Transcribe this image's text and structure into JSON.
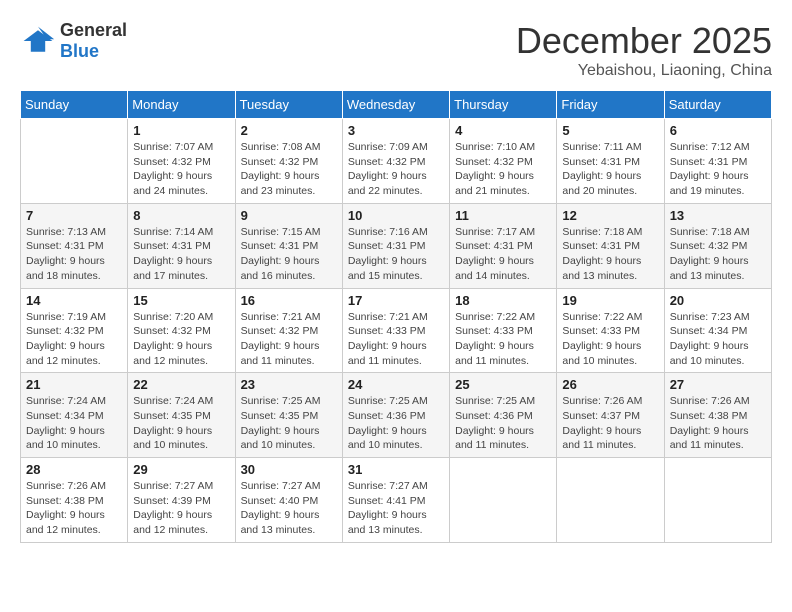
{
  "logo": {
    "line1": "General",
    "line2": "Blue"
  },
  "title": "December 2025",
  "subtitle": "Yebaishou, Liaoning, China",
  "days_of_week": [
    "Sunday",
    "Monday",
    "Tuesday",
    "Wednesday",
    "Thursday",
    "Friday",
    "Saturday"
  ],
  "weeks": [
    [
      {
        "day": "",
        "info": ""
      },
      {
        "day": "1",
        "info": "Sunrise: 7:07 AM\nSunset: 4:32 PM\nDaylight: 9 hours\nand 24 minutes."
      },
      {
        "day": "2",
        "info": "Sunrise: 7:08 AM\nSunset: 4:32 PM\nDaylight: 9 hours\nand 23 minutes."
      },
      {
        "day": "3",
        "info": "Sunrise: 7:09 AM\nSunset: 4:32 PM\nDaylight: 9 hours\nand 22 minutes."
      },
      {
        "day": "4",
        "info": "Sunrise: 7:10 AM\nSunset: 4:32 PM\nDaylight: 9 hours\nand 21 minutes."
      },
      {
        "day": "5",
        "info": "Sunrise: 7:11 AM\nSunset: 4:31 PM\nDaylight: 9 hours\nand 20 minutes."
      },
      {
        "day": "6",
        "info": "Sunrise: 7:12 AM\nSunset: 4:31 PM\nDaylight: 9 hours\nand 19 minutes."
      }
    ],
    [
      {
        "day": "7",
        "info": "Sunrise: 7:13 AM\nSunset: 4:31 PM\nDaylight: 9 hours\nand 18 minutes."
      },
      {
        "day": "8",
        "info": "Sunrise: 7:14 AM\nSunset: 4:31 PM\nDaylight: 9 hours\nand 17 minutes."
      },
      {
        "day": "9",
        "info": "Sunrise: 7:15 AM\nSunset: 4:31 PM\nDaylight: 9 hours\nand 16 minutes."
      },
      {
        "day": "10",
        "info": "Sunrise: 7:16 AM\nSunset: 4:31 PM\nDaylight: 9 hours\nand 15 minutes."
      },
      {
        "day": "11",
        "info": "Sunrise: 7:17 AM\nSunset: 4:31 PM\nDaylight: 9 hours\nand 14 minutes."
      },
      {
        "day": "12",
        "info": "Sunrise: 7:18 AM\nSunset: 4:31 PM\nDaylight: 9 hours\nand 13 minutes."
      },
      {
        "day": "13",
        "info": "Sunrise: 7:18 AM\nSunset: 4:32 PM\nDaylight: 9 hours\nand 13 minutes."
      }
    ],
    [
      {
        "day": "14",
        "info": "Sunrise: 7:19 AM\nSunset: 4:32 PM\nDaylight: 9 hours\nand 12 minutes."
      },
      {
        "day": "15",
        "info": "Sunrise: 7:20 AM\nSunset: 4:32 PM\nDaylight: 9 hours\nand 12 minutes."
      },
      {
        "day": "16",
        "info": "Sunrise: 7:21 AM\nSunset: 4:32 PM\nDaylight: 9 hours\nand 11 minutes."
      },
      {
        "day": "17",
        "info": "Sunrise: 7:21 AM\nSunset: 4:33 PM\nDaylight: 9 hours\nand 11 minutes."
      },
      {
        "day": "18",
        "info": "Sunrise: 7:22 AM\nSunset: 4:33 PM\nDaylight: 9 hours\nand 11 minutes."
      },
      {
        "day": "19",
        "info": "Sunrise: 7:22 AM\nSunset: 4:33 PM\nDaylight: 9 hours\nand 10 minutes."
      },
      {
        "day": "20",
        "info": "Sunrise: 7:23 AM\nSunset: 4:34 PM\nDaylight: 9 hours\nand 10 minutes."
      }
    ],
    [
      {
        "day": "21",
        "info": "Sunrise: 7:24 AM\nSunset: 4:34 PM\nDaylight: 9 hours\nand 10 minutes."
      },
      {
        "day": "22",
        "info": "Sunrise: 7:24 AM\nSunset: 4:35 PM\nDaylight: 9 hours\nand 10 minutes."
      },
      {
        "day": "23",
        "info": "Sunrise: 7:25 AM\nSunset: 4:35 PM\nDaylight: 9 hours\nand 10 minutes."
      },
      {
        "day": "24",
        "info": "Sunrise: 7:25 AM\nSunset: 4:36 PM\nDaylight: 9 hours\nand 10 minutes."
      },
      {
        "day": "25",
        "info": "Sunrise: 7:25 AM\nSunset: 4:36 PM\nDaylight: 9 hours\nand 11 minutes."
      },
      {
        "day": "26",
        "info": "Sunrise: 7:26 AM\nSunset: 4:37 PM\nDaylight: 9 hours\nand 11 minutes."
      },
      {
        "day": "27",
        "info": "Sunrise: 7:26 AM\nSunset: 4:38 PM\nDaylight: 9 hours\nand 11 minutes."
      }
    ],
    [
      {
        "day": "28",
        "info": "Sunrise: 7:26 AM\nSunset: 4:38 PM\nDaylight: 9 hours\nand 12 minutes."
      },
      {
        "day": "29",
        "info": "Sunrise: 7:27 AM\nSunset: 4:39 PM\nDaylight: 9 hours\nand 12 minutes."
      },
      {
        "day": "30",
        "info": "Sunrise: 7:27 AM\nSunset: 4:40 PM\nDaylight: 9 hours\nand 13 minutes."
      },
      {
        "day": "31",
        "info": "Sunrise: 7:27 AM\nSunset: 4:41 PM\nDaylight: 9 hours\nand 13 minutes."
      },
      {
        "day": "",
        "info": ""
      },
      {
        "day": "",
        "info": ""
      },
      {
        "day": "",
        "info": ""
      }
    ]
  ]
}
